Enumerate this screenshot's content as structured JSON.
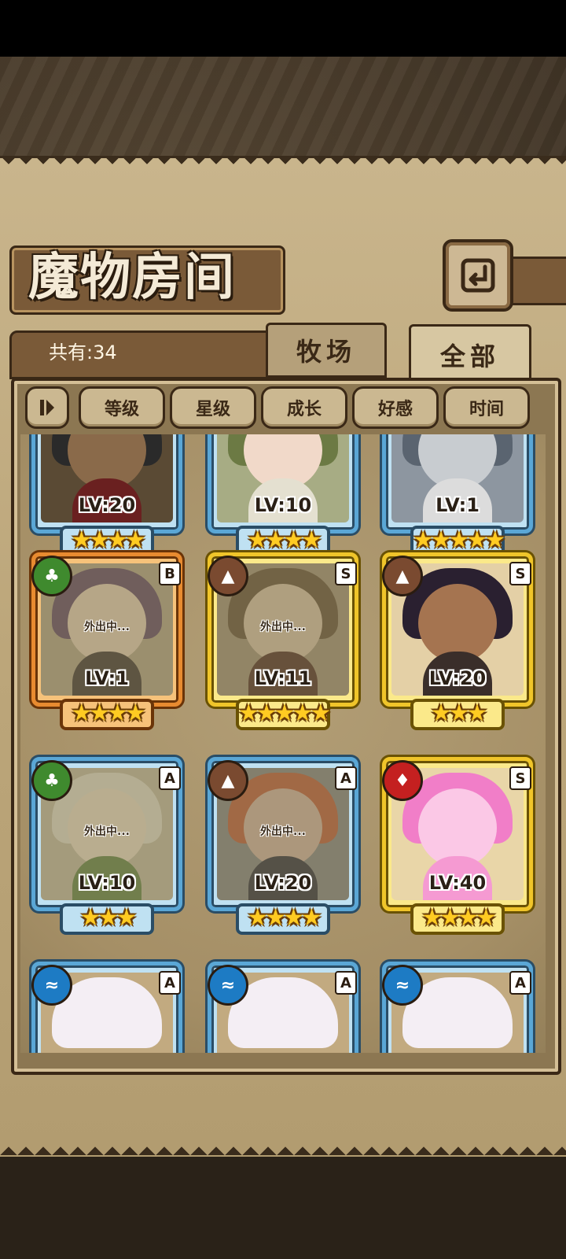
{
  "header": {
    "title": "魔物房间",
    "count_label": "共有:34"
  },
  "tabs": [
    {
      "label": "牧场",
      "active": false
    },
    {
      "label": "全部",
      "active": true
    }
  ],
  "sort": {
    "toggle_icon": "sort-toggle-icon",
    "buttons": [
      "等级",
      "星级",
      "成长",
      "好感",
      "时间"
    ]
  },
  "away_label": "外出中...",
  "cards": [
    {
      "level": "LV:20",
      "stars": "★★★★",
      "frame": "blue"
    },
    {
      "level": "LV:10",
      "stars": "★★★★",
      "frame": "blue"
    },
    {
      "level": "LV:1",
      "stars": "★★★★★",
      "frame": "blue"
    },
    {
      "level": "LV:1",
      "stars": "★★★★",
      "frame": "orange",
      "element": "grass",
      "rank": "B",
      "away": true
    },
    {
      "level": "LV:11",
      "stars": "★★★★★",
      "frame": "gold",
      "element": "earth",
      "rank": "S",
      "away": true
    },
    {
      "level": "LV:20",
      "stars": "★★★",
      "frame": "gold",
      "element": "earth",
      "rank": "S",
      "away": false
    },
    {
      "level": "LV:10",
      "stars": "★★★",
      "frame": "blue",
      "element": "grass",
      "rank": "A",
      "away": true
    },
    {
      "level": "LV:20",
      "stars": "★★★★",
      "frame": "blue",
      "element": "earth",
      "rank": "A",
      "away": true
    },
    {
      "level": "LV:40",
      "stars": "★★★★",
      "frame": "gold",
      "element": "fire",
      "rank": "S",
      "away": false
    },
    {
      "frame": "blue",
      "element": "water",
      "rank": "A"
    },
    {
      "frame": "blue",
      "element": "water",
      "rank": "A"
    },
    {
      "frame": "blue",
      "element": "water",
      "rank": "A"
    }
  ],
  "colors": {
    "panel": "#bca67a",
    "frame_blue": "#5aa7d6",
    "frame_orange": "#e88b30",
    "frame_gold": "#f0c52a",
    "star": "#ffcb22"
  }
}
